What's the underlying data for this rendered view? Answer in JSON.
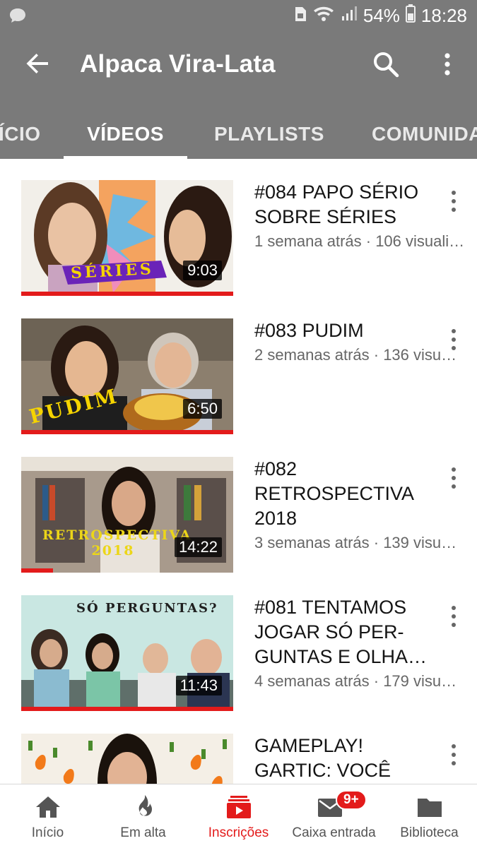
{
  "status_bar": {
    "battery": "54%",
    "time": "18:28",
    "icons": [
      "chat-icon",
      "sim-icon",
      "wifi-icon",
      "signal-icon",
      "battery-icon"
    ]
  },
  "app_bar": {
    "title": "Alpaca Vira-Lata",
    "icons": [
      "back-arrow-icon",
      "search-icon",
      "more-vert-icon"
    ],
    "background": "#7a7a7a"
  },
  "tabs": [
    {
      "label": "ÍCIO",
      "active": false
    },
    {
      "label": "VÍDEOS",
      "active": true
    },
    {
      "label": "PLAYLISTS",
      "active": false
    },
    {
      "label": "COMUNIDA",
      "active": false
    }
  ],
  "videos": [
    {
      "title": "#084 PAPO SÉRIO\nSOBRE SÉRIES",
      "meta": "1 semana atrás · 106 visuali…",
      "duration": "9:03",
      "watched_fraction": 1.0,
      "thumb_caption": "SÉRIES"
    },
    {
      "title": "#083 PUDIM",
      "meta": "2 semanas atrás · 136 visu…",
      "duration": "6:50",
      "watched_fraction": 1.0,
      "thumb_caption": "PUDIM"
    },
    {
      "title": "#082\nRETROSPECTIVA\n2018",
      "meta": "3 semanas atrás · 139 visu…",
      "duration": "14:22",
      "watched_fraction": 0.15,
      "thumb_caption": "RETROSPECTIVA 2018"
    },
    {
      "title": "#081 TENTAMOS\nJOGAR SÓ PER-\nGUNTAS E OLHA…",
      "meta": "4 semanas atrás · 179 visu…",
      "duration": "11:43",
      "watched_fraction": 1.0,
      "thumb_caption": "SÓ PERGUNTAS?"
    },
    {
      "title": "GAMEPLAY!\nGARTIC: VOCÊ",
      "meta": "",
      "duration": "",
      "watched_fraction": 0,
      "thumb_caption": ""
    }
  ],
  "bottom_nav": [
    {
      "label": "Início",
      "icon": "home-icon",
      "active": false
    },
    {
      "label": "Em alta",
      "icon": "flame-icon",
      "active": false
    },
    {
      "label": "Inscrições",
      "icon": "subscriptions-icon",
      "active": true
    },
    {
      "label": "Caixa entrada",
      "icon": "mail-icon",
      "active": false,
      "badge": "9+"
    },
    {
      "label": "Biblioteca",
      "icon": "folder-icon",
      "active": false
    }
  ],
  "colors": {
    "accent": "#e31b1b",
    "chrome": "#7a7a7a"
  }
}
